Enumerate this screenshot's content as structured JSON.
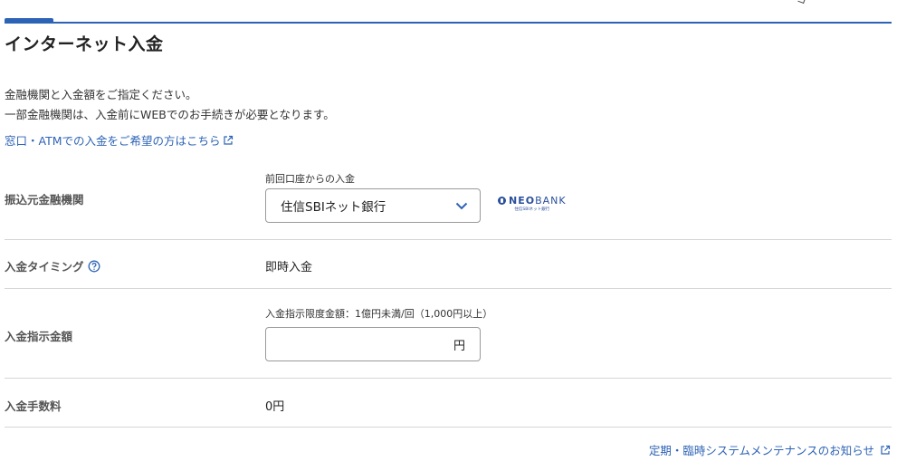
{
  "page": {
    "title": "インターネット入金",
    "intro_line1": "金融機関と入金額をご指定ください。",
    "intro_line2": "一部金融機関は、入金前にWEBでのお手続きが必要となります。",
    "counter_atm_link": "窓口・ATMでの入金をご希望の方はこちら"
  },
  "form": {
    "source_bank": {
      "label": "振込元金融機関",
      "hint": "前回口座からの入金",
      "selected": "住信SBIネット銀行",
      "logo_neo": "NEO",
      "logo_bank": "BANK",
      "logo_sub": "住信SBIネット銀行"
    },
    "timing": {
      "label": "入金タイミング",
      "value": "即時入金"
    },
    "amount": {
      "label": "入金指示金額",
      "hint": "入金指示限度金額：1億円未満/回（1,000円以上）",
      "value": "",
      "unit": "円"
    },
    "fee": {
      "label": "入金手数料",
      "value": "0円"
    }
  },
  "footer": {
    "maintenance_link": "定期・臨時システムメンテナンスのお知らせ"
  },
  "colors": {
    "accent": "#2d63b5",
    "divider": "#d6d6d6",
    "logo": "#2a4f9c"
  },
  "icons": {
    "external": "external-link-icon",
    "chevron": "chevron-down-icon",
    "help": "help-circle-icon"
  }
}
